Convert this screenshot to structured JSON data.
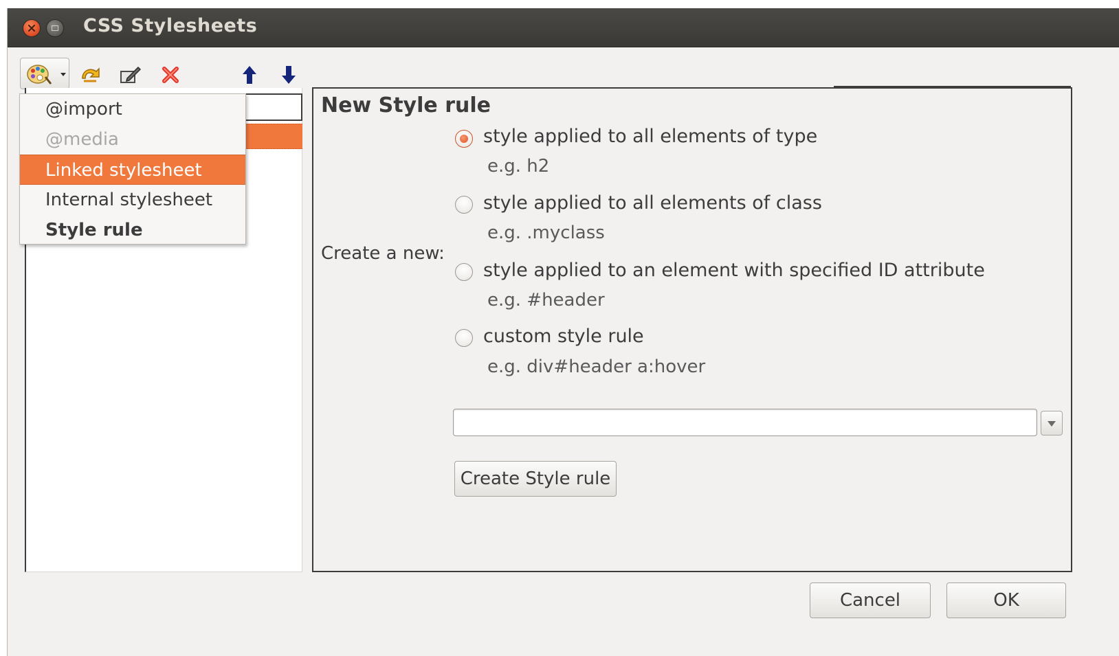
{
  "window": {
    "title": "CSS Stylesheets"
  },
  "toolbar": {
    "icons": [
      "palette-add-icon",
      "dropdown-caret-icon",
      "import-arrow-icon",
      "edit-icon",
      "delete-icon",
      "move-up-icon",
      "move-down-icon"
    ]
  },
  "add_menu": {
    "items": [
      {
        "label": "@import",
        "state": "normal"
      },
      {
        "label": "@media",
        "state": "disabled"
      },
      {
        "label": "Linked stylesheet",
        "state": "highlighted"
      },
      {
        "label": "Internal stylesheet",
        "state": "normal"
      },
      {
        "label": "Style rule",
        "state": "bold"
      }
    ]
  },
  "panel": {
    "title": "New Style rule",
    "create_label": "Create a new:",
    "options": [
      {
        "label": "style applied to all elements of type",
        "example": "e.g. h2",
        "checked": true
      },
      {
        "label": "style applied to all elements of class",
        "example": "e.g. .myclass",
        "checked": false
      },
      {
        "label": "style applied to an element with specified ID attribute",
        "example": "e.g. #header",
        "checked": false
      },
      {
        "label": "custom style rule",
        "example": "e.g. div#header a:hover",
        "checked": false
      }
    ],
    "selector_input": {
      "value": "",
      "placeholder": ""
    },
    "create_button": "Create Style rule"
  },
  "footer": {
    "cancel_label": "Cancel",
    "ok_label": "OK"
  },
  "colors": {
    "accent": "#f0783c",
    "titlebar": "#3c3b37",
    "window_bg": "#f2f1f0"
  }
}
